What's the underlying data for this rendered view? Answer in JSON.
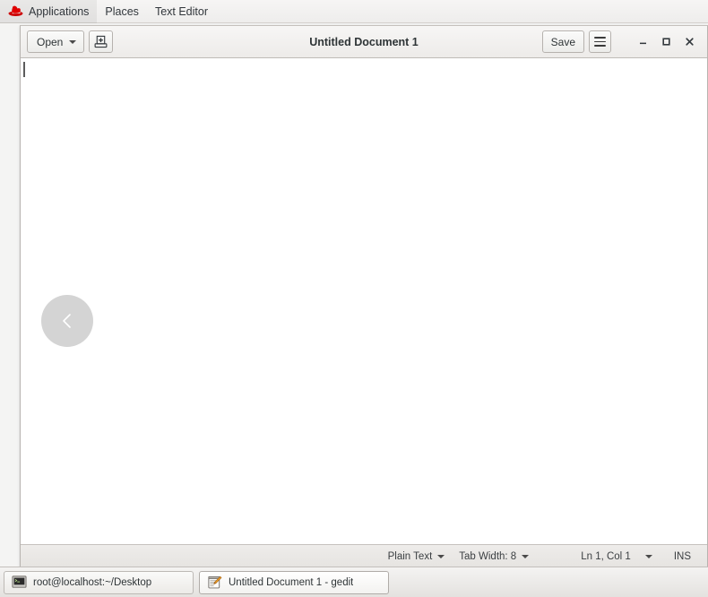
{
  "desktop": {
    "panel": {
      "logo_icon": "red-hat-logo-icon",
      "menus": [
        {
          "label": "Applications"
        },
        {
          "label": "Places"
        },
        {
          "label": "Text Editor"
        }
      ]
    },
    "taskbar": {
      "items": [
        {
          "label": "root@localhost:~/Desktop",
          "icon": "terminal-icon",
          "active": false
        },
        {
          "label": "Untitled Document 1 - gedit",
          "icon": "gedit-icon",
          "active": true
        }
      ]
    }
  },
  "window": {
    "title": "Untitled Document 1",
    "headerbar": {
      "open_label": "Open",
      "open_caret_icon": "chevron-down-icon",
      "new_document_icon": "new-document-icon",
      "save_label": "Save",
      "menu_icon": "hamburger-menu-icon",
      "minimize_icon": "minimize-icon",
      "maximize_icon": "maximize-icon",
      "close_icon": "close-icon"
    },
    "document": {
      "content": "",
      "panel_reveal_icon": "chevron-left-icon"
    },
    "statusbar": {
      "language": "Plain Text",
      "language_caret_icon": "chevron-down-icon",
      "tab_width": "Tab Width: 8",
      "tab_width_caret_icon": "chevron-down-icon",
      "position": "Ln 1, Col 1",
      "position_caret_icon": "chevron-down-icon",
      "insert_mode": "INS"
    }
  },
  "colors": {
    "panel_bg": "#f6f5f4",
    "window_bg": "#ffffff",
    "headerbar_bg": "#f1efed",
    "statusbar_bg": "#eae8e5",
    "taskbar_bg": "#eceae7",
    "text": "#2e3436",
    "redhat_red": "#cc0000",
    "reveal_circle": "#d4d4d4"
  }
}
